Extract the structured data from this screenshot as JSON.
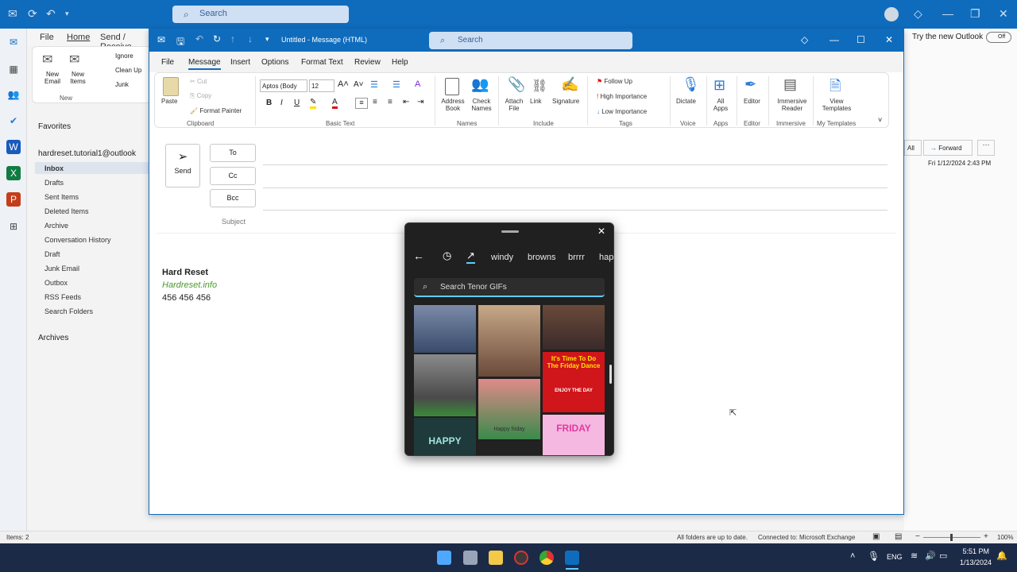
{
  "background": {
    "search_label": "Search",
    "try_new_outlook": "Try the new Outlook",
    "toggle_state": "Off",
    "menu": [
      "File",
      "Home",
      "Send / Receive"
    ],
    "ribbon": {
      "new_email": "New Email",
      "new_items": "New Items",
      "ignore": "Ignore",
      "clean_up": "Clean Up",
      "junk": "Junk",
      "group_new": "New"
    },
    "account": "hardreset.tutorial1@outlook",
    "favorites": "Favorites",
    "folders": [
      "Inbox",
      "Drafts",
      "Sent Items",
      "Deleted Items",
      "Archive",
      "Conversation History",
      "Draft",
      "Junk Email",
      "Outbox",
      "RSS Feeds",
      "Search Folders"
    ],
    "archives": "Archives",
    "reading": {
      "reply_all": "All",
      "forward": "Forward",
      "date": "Fri 1/12/2024 2:43 PM"
    }
  },
  "compose": {
    "title": "Untitled - Message (HTML)",
    "search_label": "Search",
    "tabs": [
      "File",
      "Message",
      "Insert",
      "Options",
      "Format Text",
      "Review",
      "Help"
    ],
    "active_tab": "Message",
    "ribbon": {
      "paste": "Paste",
      "cut": "Cut",
      "copy": "Copy",
      "format_painter": "Format Painter",
      "font": "Aptos (Body",
      "size": "12",
      "address_book": "Address Book",
      "check_names": "Check Names",
      "attach_file": "Attach File",
      "link": "Link",
      "signature": "Signature",
      "follow_up": "Follow Up",
      "high_importance": "High Importance",
      "low_importance": "Low Importance",
      "dictate": "Dictate",
      "all_apps": "All Apps",
      "editor": "Editor",
      "immersive_reader": "Immersive Reader",
      "view_templates": "View Templates",
      "groups": {
        "clipboard": "Clipboard",
        "basic_text": "Basic Text",
        "names": "Names",
        "include": "Include",
        "tags": "Tags",
        "voice": "Voice",
        "apps": "Apps",
        "editor": "Editor",
        "immersive": "Immersive",
        "my_templates": "My Templates"
      }
    },
    "send": "Send",
    "to": "To",
    "cc": "Cc",
    "bcc": "Bcc",
    "subject": "Subject",
    "signature": {
      "name": "Hard Reset",
      "site": "Hardreset.info",
      "phone": "456 456 456"
    }
  },
  "gif_panel": {
    "tags": [
      "windy",
      "browns",
      "brrrr",
      "hap"
    ],
    "search_placeholder": "Search Tenor GIFs",
    "gif_texts": {
      "friday_dance": "It's Time To Do The Friday Dance",
      "enjoy": "ENJOY THE DAY",
      "happy_friday": "HAPPY FRIDAY",
      "happy_friday2": "Happy friday",
      "happy_small": "HAPPY",
      "happy_big": "FRIDAY"
    }
  },
  "statusbar": {
    "items": "Items: 2",
    "sync": "All folders are up to date.",
    "connection": "Connected to: Microsoft Exchange",
    "zoom": "100%"
  },
  "taskbar": {
    "lang": "ENG",
    "time": "5:51 PM",
    "date": "1/13/2024"
  },
  "colors": {
    "accent": "#0f6cbd",
    "taskbar": "#1b2a47",
    "gif_panel": "#202020",
    "link_green": "#4a9a2a"
  }
}
